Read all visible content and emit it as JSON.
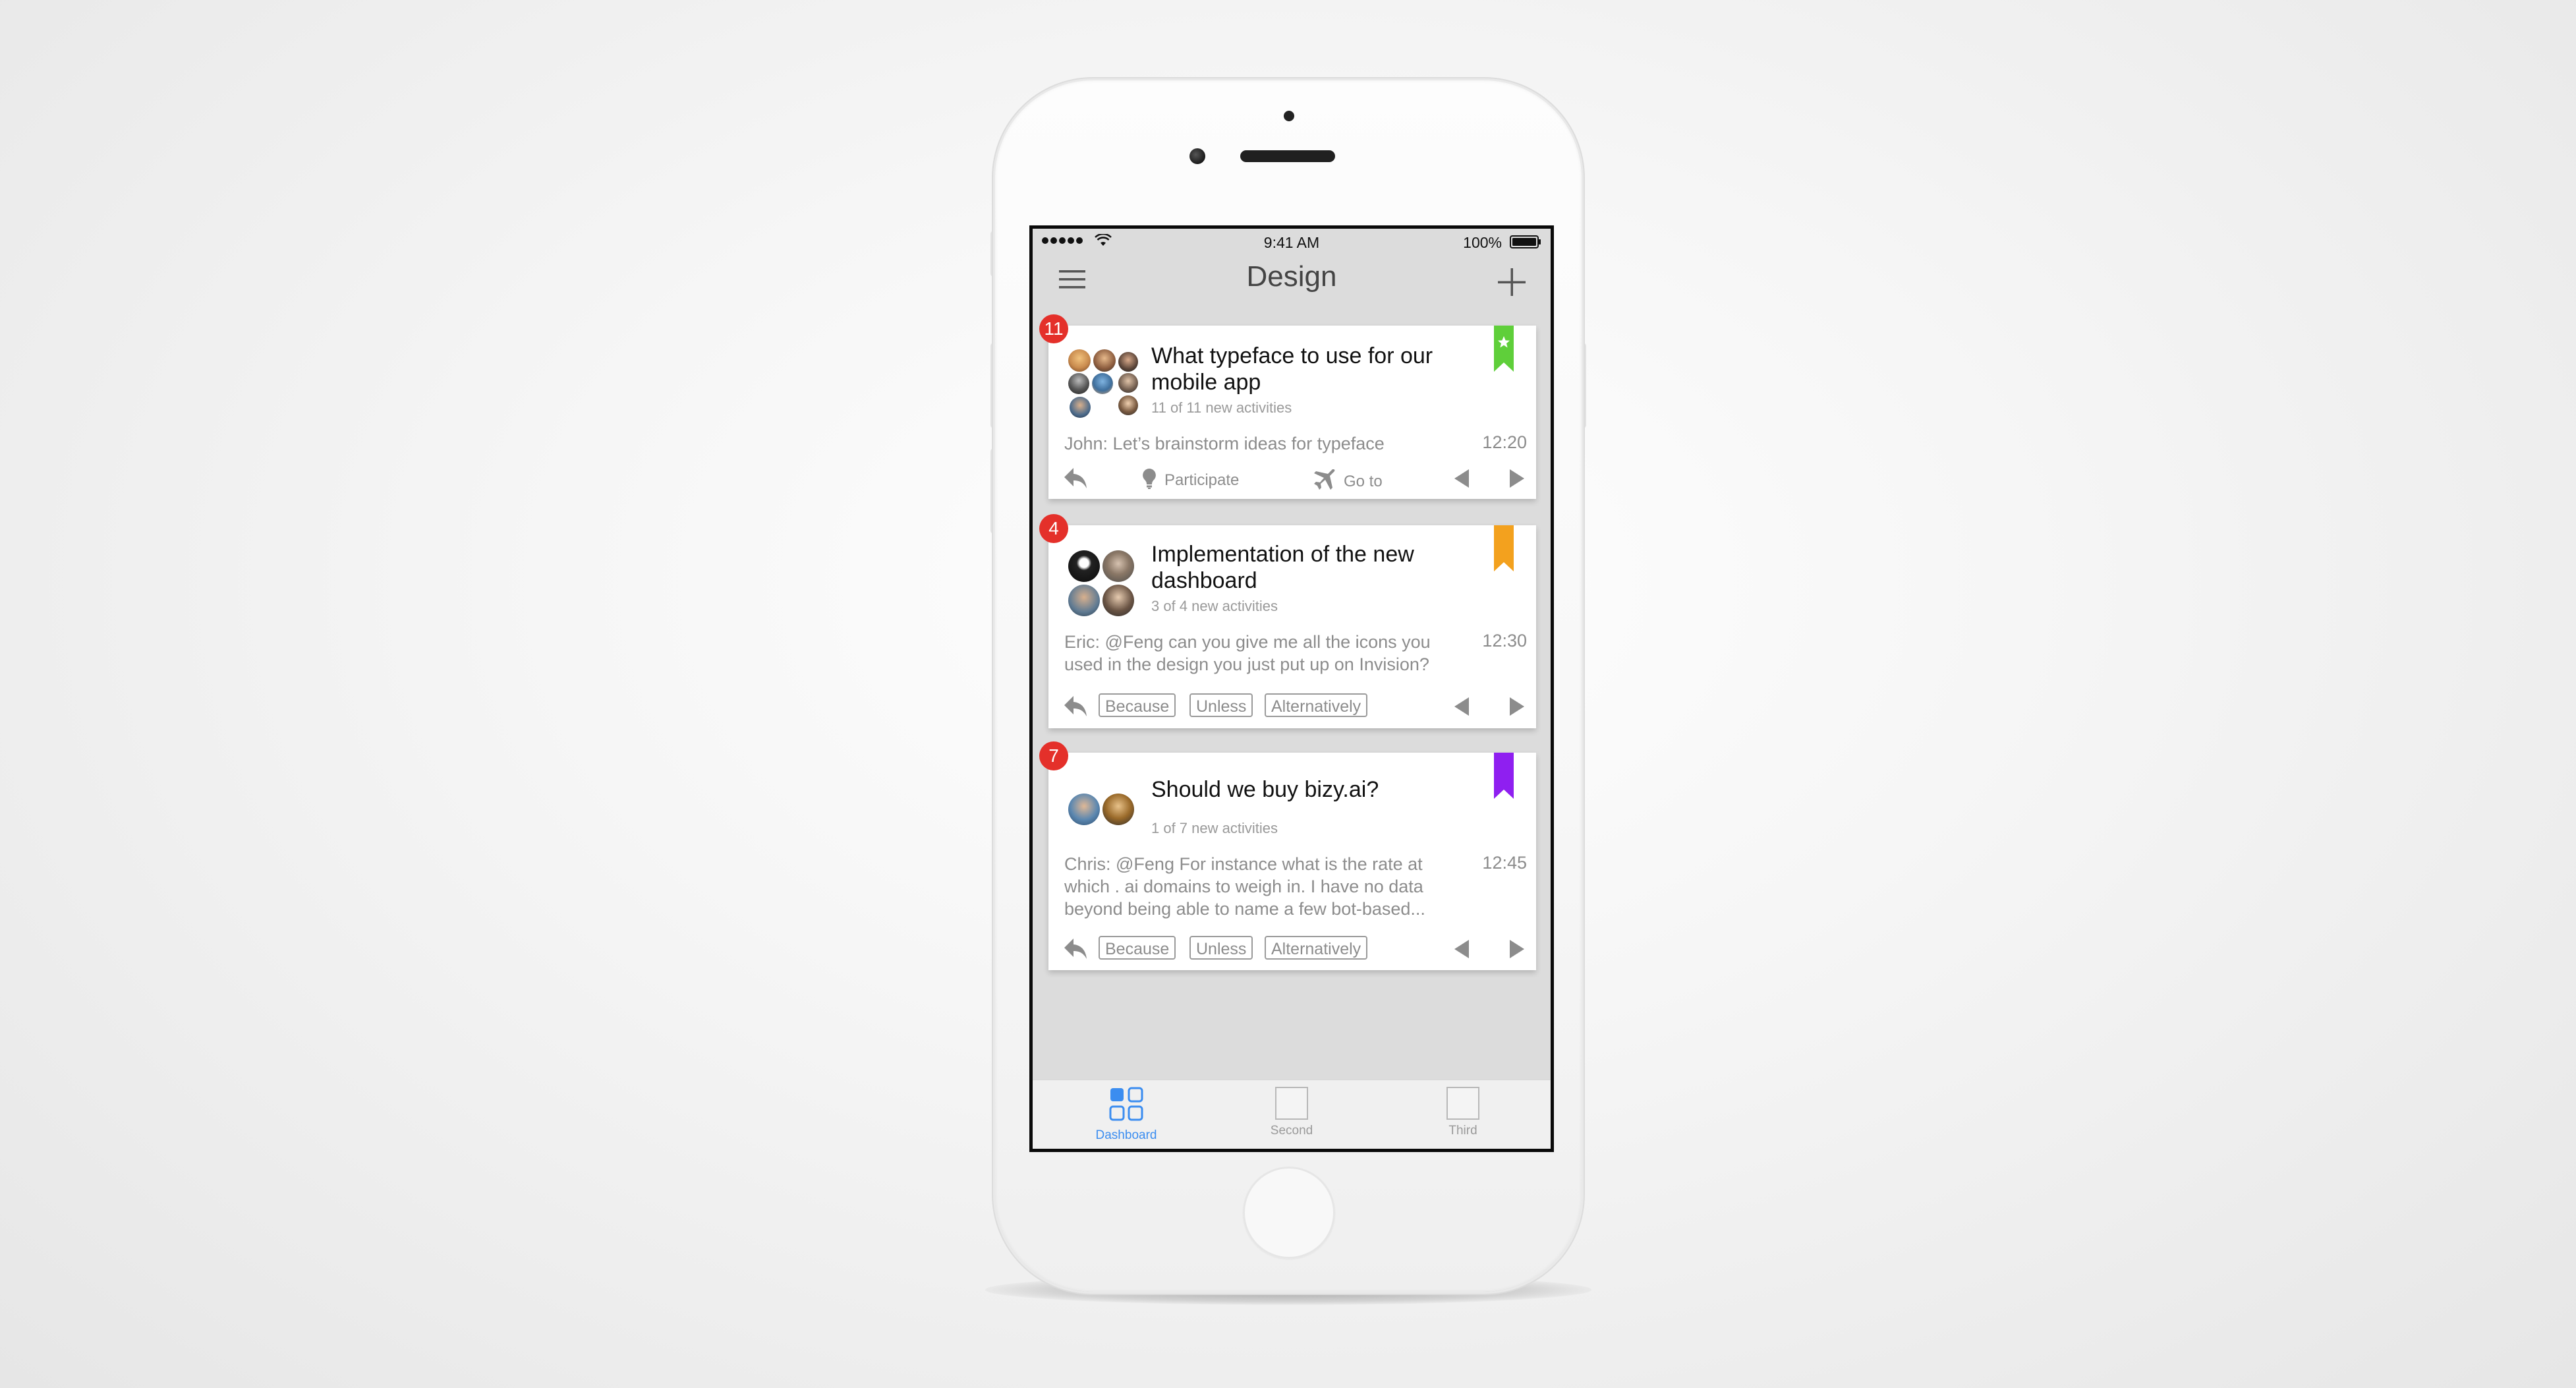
{
  "status_bar": {
    "time": "9:41 AM",
    "battery": "100%"
  },
  "nav": {
    "title": "Design"
  },
  "cards": [
    {
      "badge": "11",
      "bookmark_color": "#5fcf3a",
      "title": "What typeface to use for our mobile app",
      "subtitle": "11 of 11 new activities",
      "message": "John: Let’s brainstorm ideas for typeface",
      "time": "12:20",
      "actions": {
        "participate": "Participate",
        "go_to": "Go to"
      }
    },
    {
      "badge": "4",
      "bookmark_color": "#f3a11e",
      "title": "Implementation of the new dashboard",
      "subtitle": "3 of 4 new activities",
      "message": "Eric: @Feng can you give me all the icons you used in the design you just put up on Invision?",
      "time": "12:30",
      "chips": [
        "Because",
        "Unless",
        "Alternatively"
      ]
    },
    {
      "badge": "7",
      "bookmark_color": "#8f1ff0",
      "title": "Should we buy bizy.ai?",
      "subtitle": "1 of 7 new activities",
      "message": "Chris: @Feng For instance what is the rate at which . ai domains to weigh in. I have no data beyond being able to name a few bot-based...",
      "time": "12:45",
      "chips": [
        "Because",
        "Unless",
        "Alternatively"
      ]
    }
  ],
  "tabs": [
    {
      "label": "Dashboard",
      "active": true
    },
    {
      "label": "Second",
      "active": false
    },
    {
      "label": "Third",
      "active": false
    }
  ],
  "colors": {
    "badge": "#e4302a",
    "active_tab": "#3b8df0",
    "screen_bg": "#dcdcdc"
  },
  "icons": [
    "menu-icon",
    "add-icon",
    "reply-icon",
    "lightbulb-icon",
    "airplane-icon",
    "arrow-left-icon",
    "arrow-right-icon",
    "star-icon",
    "wifi-icon",
    "battery-icon"
  ]
}
